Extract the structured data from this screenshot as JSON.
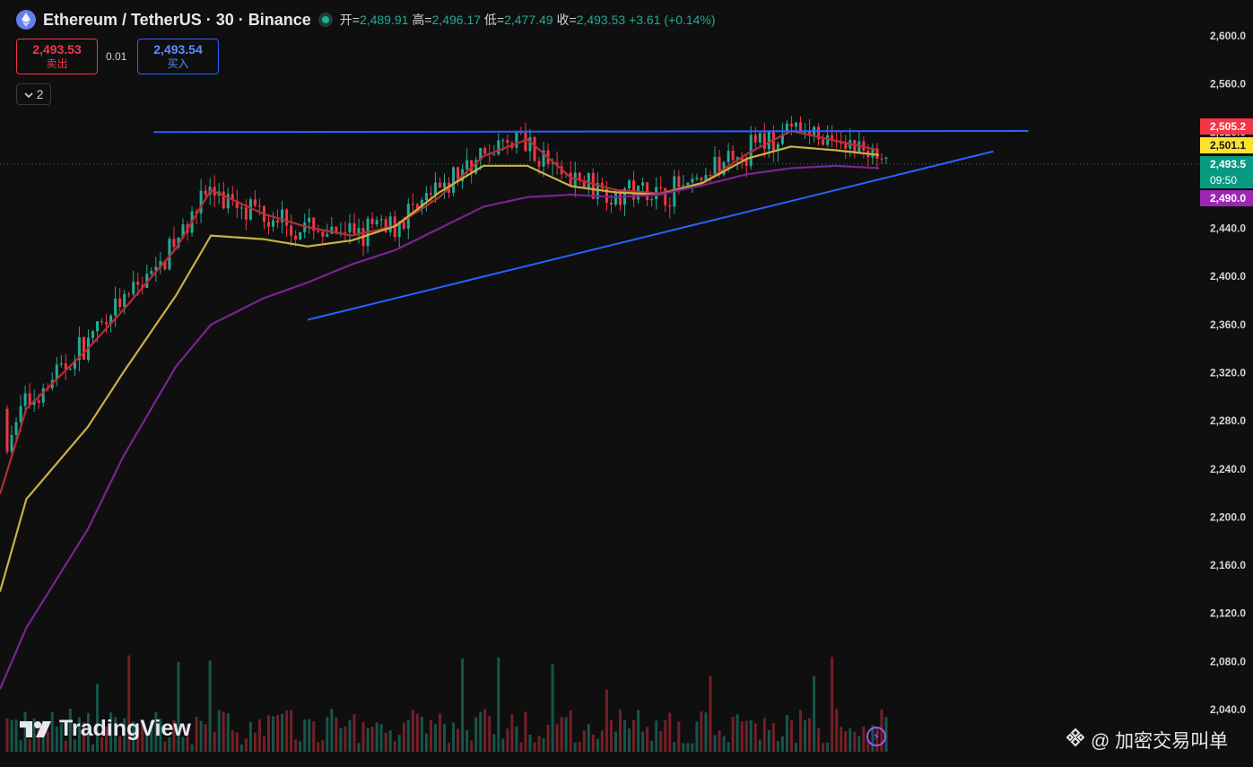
{
  "header": {
    "symbol_title": "Ethereum / TetherUS · 30 · Binance",
    "open_label": "开=",
    "open_value": "2,489.91",
    "high_label": "高=",
    "high_value": "2,496.17",
    "low_label": "低=",
    "low_value": "2,477.49",
    "close_label": "收=",
    "close_value": "2,493.53",
    "change": "+3.61 (+0.14%)"
  },
  "trade": {
    "sell_price": "2,493.53",
    "sell_label": "卖出",
    "spread": "0.01",
    "buy_price": "2,493.54",
    "buy_label": "买入"
  },
  "indicator_toggle": {
    "count": "2"
  },
  "price_tags": {
    "red": "2,505.2",
    "yellow": "2,501.1",
    "last": "2,493.5",
    "countdown": "09:50",
    "purple": "2,490.0"
  },
  "colors": {
    "background": "#0f0f0f",
    "up": "#22ab94",
    "down": "#f23645",
    "ma_red": "#b52d36",
    "ma_yellow": "#c9b245",
    "ma_purple": "#7a2394",
    "trendline": "#2962ff",
    "tag_red": "#f23645",
    "tag_yellow": "#fbe32d",
    "tag_green": "#089981",
    "tag_purple": "#9c27b0"
  },
  "logo_text": "TradingView",
  "watermark": "@ 加密交易叫单",
  "chart_data": {
    "type": "candlestick",
    "title": "Ethereum / TetherUS · 30 · Binance",
    "y_axis": {
      "ticks": [
        2600,
        2560,
        2520,
        2480,
        2440,
        2400,
        2360,
        2320,
        2280,
        2240,
        2200,
        2160,
        2120,
        2080,
        2040
      ],
      "tick_labels": [
        "2,600.0",
        "2,560.0",
        "2,520.0",
        "2,480.0",
        "2,440.0",
        "2,400.0",
        "2,360.0",
        "2,320.0",
        "2,280.0",
        "2,240.0",
        "2,200.0",
        "2,160.0",
        "2,120.0",
        "2,080.0",
        "2,040.0"
      ]
    },
    "last_price": 2493.53,
    "moving_averages": [
      {
        "color": "red",
        "last_value": 2505.2,
        "path_t": [
          0,
          0.03,
          0.1,
          0.14,
          0.2,
          0.24,
          0.3,
          0.35,
          0.4,
          0.45,
          0.5,
          0.55,
          0.6,
          0.65,
          0.7,
          0.75,
          0.8,
          0.85,
          0.9,
          0.95,
          1
        ],
        "path_price": [
          2219,
          2290,
          2340,
          2372,
          2423,
          2472,
          2452,
          2441,
          2434,
          2442,
          2466,
          2500,
          2514,
          2482,
          2472,
          2469,
          2478,
          2502,
          2521,
          2513,
          2505
        ]
      },
      {
        "color": "yellow",
        "last_value": 2501.1,
        "path_t": [
          0,
          0.03,
          0.1,
          0.14,
          0.2,
          0.24,
          0.3,
          0.35,
          0.4,
          0.45,
          0.5,
          0.55,
          0.6,
          0.65,
          0.7,
          0.75,
          0.8,
          0.85,
          0.9,
          0.95,
          1
        ],
        "path_price": [
          2138,
          2215,
          2275,
          2320,
          2384,
          2434,
          2431,
          2425,
          2430,
          2442,
          2470,
          2492,
          2492,
          2475,
          2470,
          2468,
          2478,
          2498,
          2508,
          2505,
          2501
        ]
      },
      {
        "color": "purple",
        "last_value": 2490.0,
        "path_t": [
          0,
          0.03,
          0.1,
          0.14,
          0.2,
          0.24,
          0.3,
          0.35,
          0.4,
          0.45,
          0.5,
          0.55,
          0.6,
          0.65,
          0.7,
          0.75,
          0.8,
          0.85,
          0.9,
          0.95,
          1
        ],
        "path_price": [
          2057,
          2108,
          2190,
          2250,
          2325,
          2360,
          2382,
          2395,
          2410,
          2422,
          2440,
          2458,
          2466,
          2468,
          2466,
          2468,
          2476,
          2485,
          2490,
          2492,
          2490
        ]
      }
    ],
    "trendlines": [
      {
        "name": "resistance",
        "t1": 0.175,
        "p1": 2520,
        "t2": 1.17,
        "p2": 2521
      },
      {
        "name": "support",
        "t1": 0.35,
        "p1": 2364,
        "t2": 1.13,
        "p2": 2504
      }
    ]
  }
}
